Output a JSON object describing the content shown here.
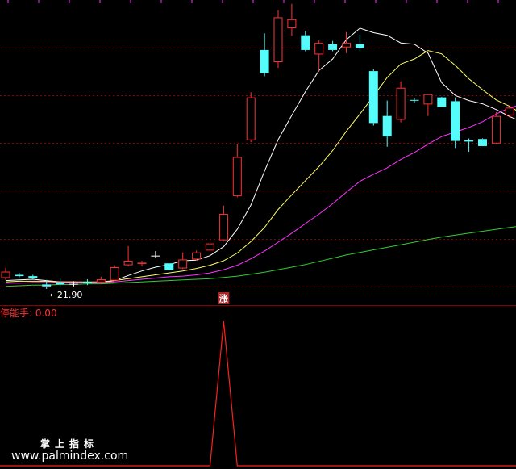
{
  "colors": {
    "background": "#000000",
    "up": "#ff3232",
    "down": "#54fcfc",
    "flat": "#ffffff",
    "grid": "#8b0000",
    "ma5": "#ffffff",
    "ma10": "#ffff66",
    "ma20": "#ff33ff",
    "ma60": "#33cc33",
    "indicator": "#ff2020",
    "label": "#ff3232",
    "badge_bg": "#aa2222",
    "badge_text": "#ffffff"
  },
  "indicator": {
    "label": "停能手: 0.00"
  },
  "badge": {
    "text": "涨"
  },
  "watermark": {
    "title": "掌上指标",
    "url": "www.palmindex.com"
  },
  "chart_data": [
    {
      "type": "candlestick",
      "price_range": [
        19.5,
        67.0
      ],
      "low_annotation": {
        "text": "←21.90",
        "index": 3,
        "value": 21.9
      },
      "candles": [
        {
          "o": 23.6,
          "h": 25.2,
          "l": 23.3,
          "c": 24.6
        },
        {
          "o": 24.1,
          "h": 24.4,
          "l": 23.7,
          "c": 23.9
        },
        {
          "o": 23.9,
          "h": 24.1,
          "l": 23.4,
          "c": 23.6
        },
        {
          "o": 22.6,
          "h": 23.3,
          "l": 21.9,
          "c": 22.3
        },
        {
          "o": 22.9,
          "h": 23.5,
          "l": 22.2,
          "c": 22.6
        },
        {
          "o": 22.7,
          "h": 23.1,
          "l": 22.3,
          "c": 22.7
        },
        {
          "o": 23.0,
          "h": 23.4,
          "l": 22.5,
          "c": 22.8
        },
        {
          "o": 22.9,
          "h": 23.8,
          "l": 22.7,
          "c": 23.4
        },
        {
          "o": 23.2,
          "h": 25.6,
          "l": 23.1,
          "c": 25.3
        },
        {
          "o": 25.6,
          "h": 28.6,
          "l": 25.4,
          "c": 26.3
        },
        {
          "o": 25.9,
          "h": 26.3,
          "l": 25.4,
          "c": 26.0
        },
        {
          "o": 27.1,
          "h": 27.8,
          "l": 26.8,
          "c": 27.1
        },
        {
          "o": 25.9,
          "h": 25.9,
          "l": 24.9,
          "c": 24.8
        },
        {
          "o": 25.1,
          "h": 27.6,
          "l": 25.0,
          "c": 26.5
        },
        {
          "o": 26.5,
          "h": 27.9,
          "l": 26.3,
          "c": 27.6
        },
        {
          "o": 27.9,
          "h": 29.2,
          "l": 27.7,
          "c": 29.0
        },
        {
          "o": 29.5,
          "h": 34.9,
          "l": 29.3,
          "c": 33.6
        },
        {
          "o": 36.4,
          "h": 44.5,
          "l": 36.2,
          "c": 42.5
        },
        {
          "o": 45.1,
          "h": 52.6,
          "l": 44.8,
          "c": 51.8
        },
        {
          "o": 59.2,
          "h": 61.8,
          "l": 55.1,
          "c": 55.6
        },
        {
          "o": 57.3,
          "h": 65.4,
          "l": 56.4,
          "c": 64.3
        },
        {
          "o": 62.6,
          "h": 66.4,
          "l": 61.4,
          "c": 64.0
        },
        {
          "o": 61.5,
          "h": 62.2,
          "l": 59.0,
          "c": 59.2
        },
        {
          "o": 58.5,
          "h": 60.7,
          "l": 55.9,
          "c": 60.3
        },
        {
          "o": 60.1,
          "h": 60.6,
          "l": 59.0,
          "c": 59.2
        },
        {
          "o": 59.6,
          "h": 62.0,
          "l": 58.7,
          "c": 60.3
        },
        {
          "o": 60.1,
          "h": 61.6,
          "l": 59.0,
          "c": 59.5
        },
        {
          "o": 55.9,
          "h": 56.2,
          "l": 47.4,
          "c": 47.8
        },
        {
          "o": 48.9,
          "h": 51.3,
          "l": 44.1,
          "c": 45.7
        },
        {
          "o": 48.3,
          "h": 54.3,
          "l": 47.9,
          "c": 53.3
        },
        {
          "o": 51.4,
          "h": 51.7,
          "l": 50.9,
          "c": 51.3
        },
        {
          "o": 50.7,
          "h": 52.0,
          "l": 48.9,
          "c": 52.3
        },
        {
          "o": 51.8,
          "h": 51.9,
          "l": 50.9,
          "c": 50.3
        },
        {
          "o": 51.2,
          "h": 51.8,
          "l": 43.9,
          "c": 45.0
        },
        {
          "o": 45.1,
          "h": 45.4,
          "l": 43.3,
          "c": 44.9
        },
        {
          "o": 45.3,
          "h": 45.4,
          "l": 44.5,
          "c": 44.2
        },
        {
          "o": 44.6,
          "h": 49.5,
          "l": 44.5,
          "c": 48.9
        },
        {
          "o": 49.0,
          "h": 50.7,
          "l": 48.6,
          "c": 50.2
        },
        {
          "o": 48.2,
          "h": 50.8,
          "l": 48.1,
          "c": 49.5
        },
        {
          "o": 50.0,
          "h": 50.9,
          "l": 48.8,
          "c": 50.4
        }
      ],
      "ma": [
        {
          "name": "MA5",
          "values": [
            23.2,
            23.3,
            23.4,
            23.2,
            23.0,
            23.0,
            22.9,
            22.9,
            23.2,
            24.0,
            24.7,
            25.3,
            25.7,
            26.3,
            26.4,
            27.1,
            28.5,
            31.2,
            35.0,
            40.3,
            45.2,
            49.0,
            52.7,
            56.0,
            57.8,
            60.8,
            62.6,
            61.9,
            61.5,
            60.3,
            60.1,
            58.7,
            54.1,
            52.1,
            51.3,
            50.8,
            49.9,
            48.8,
            47.9,
            47.9
          ]
        },
        {
          "name": "MA10",
          "values": [
            23.0,
            23.1,
            23.1,
            23.1,
            23.0,
            23.0,
            23.0,
            23.0,
            23.2,
            23.5,
            23.8,
            24.1,
            24.4,
            24.7,
            25.1,
            25.6,
            26.3,
            27.5,
            29.3,
            31.5,
            34.3,
            36.6,
            38.8,
            41.0,
            43.5,
            46.5,
            49.2,
            52.0,
            54.9,
            57.0,
            57.8,
            59.1,
            58.6,
            56.8,
            54.7,
            53.0,
            51.4,
            50.4,
            49.1,
            48.7
          ]
        },
        {
          "name": "MA20",
          "values": [
            22.8,
            22.8,
            22.9,
            22.9,
            22.9,
            22.9,
            22.9,
            22.9,
            23.0,
            23.2,
            23.4,
            23.6,
            23.8,
            23.9,
            24.1,
            24.4,
            24.9,
            25.6,
            26.6,
            27.8,
            29.2,
            30.6,
            32.1,
            33.6,
            35.2,
            37.0,
            38.7,
            39.8,
            40.8,
            42.1,
            43.2,
            44.5,
            45.7,
            46.4,
            47.1,
            48.0,
            49.2,
            50.2,
            50.7,
            50.8
          ]
        },
        {
          "name": "MA60",
          "values": [
            22.3,
            22.4,
            22.5,
            22.5,
            22.6,
            22.6,
            22.7,
            22.7,
            22.8,
            22.9,
            23.0,
            23.1,
            23.2,
            23.3,
            23.4,
            23.5,
            23.7,
            23.9,
            24.2,
            24.5,
            24.9,
            25.3,
            25.7,
            26.2,
            26.7,
            27.2,
            27.6,
            28.0,
            28.4,
            28.8,
            29.2,
            29.6,
            30.0,
            30.3,
            30.6,
            30.9,
            31.2,
            31.5,
            31.8,
            32.2
          ]
        }
      ]
    },
    {
      "type": "line",
      "series": [
        {
          "values": [
            0,
            0,
            0,
            0,
            0,
            0,
            0,
            0,
            0,
            0,
            0,
            0,
            0,
            0,
            0,
            0,
            1,
            0,
            0,
            0,
            0,
            0,
            0,
            0,
            0,
            0,
            0,
            0,
            0,
            0,
            0,
            0,
            0,
            0,
            0,
            0,
            0,
            0,
            0,
            0
          ]
        }
      ],
      "ylim": [
        0,
        1
      ]
    }
  ]
}
